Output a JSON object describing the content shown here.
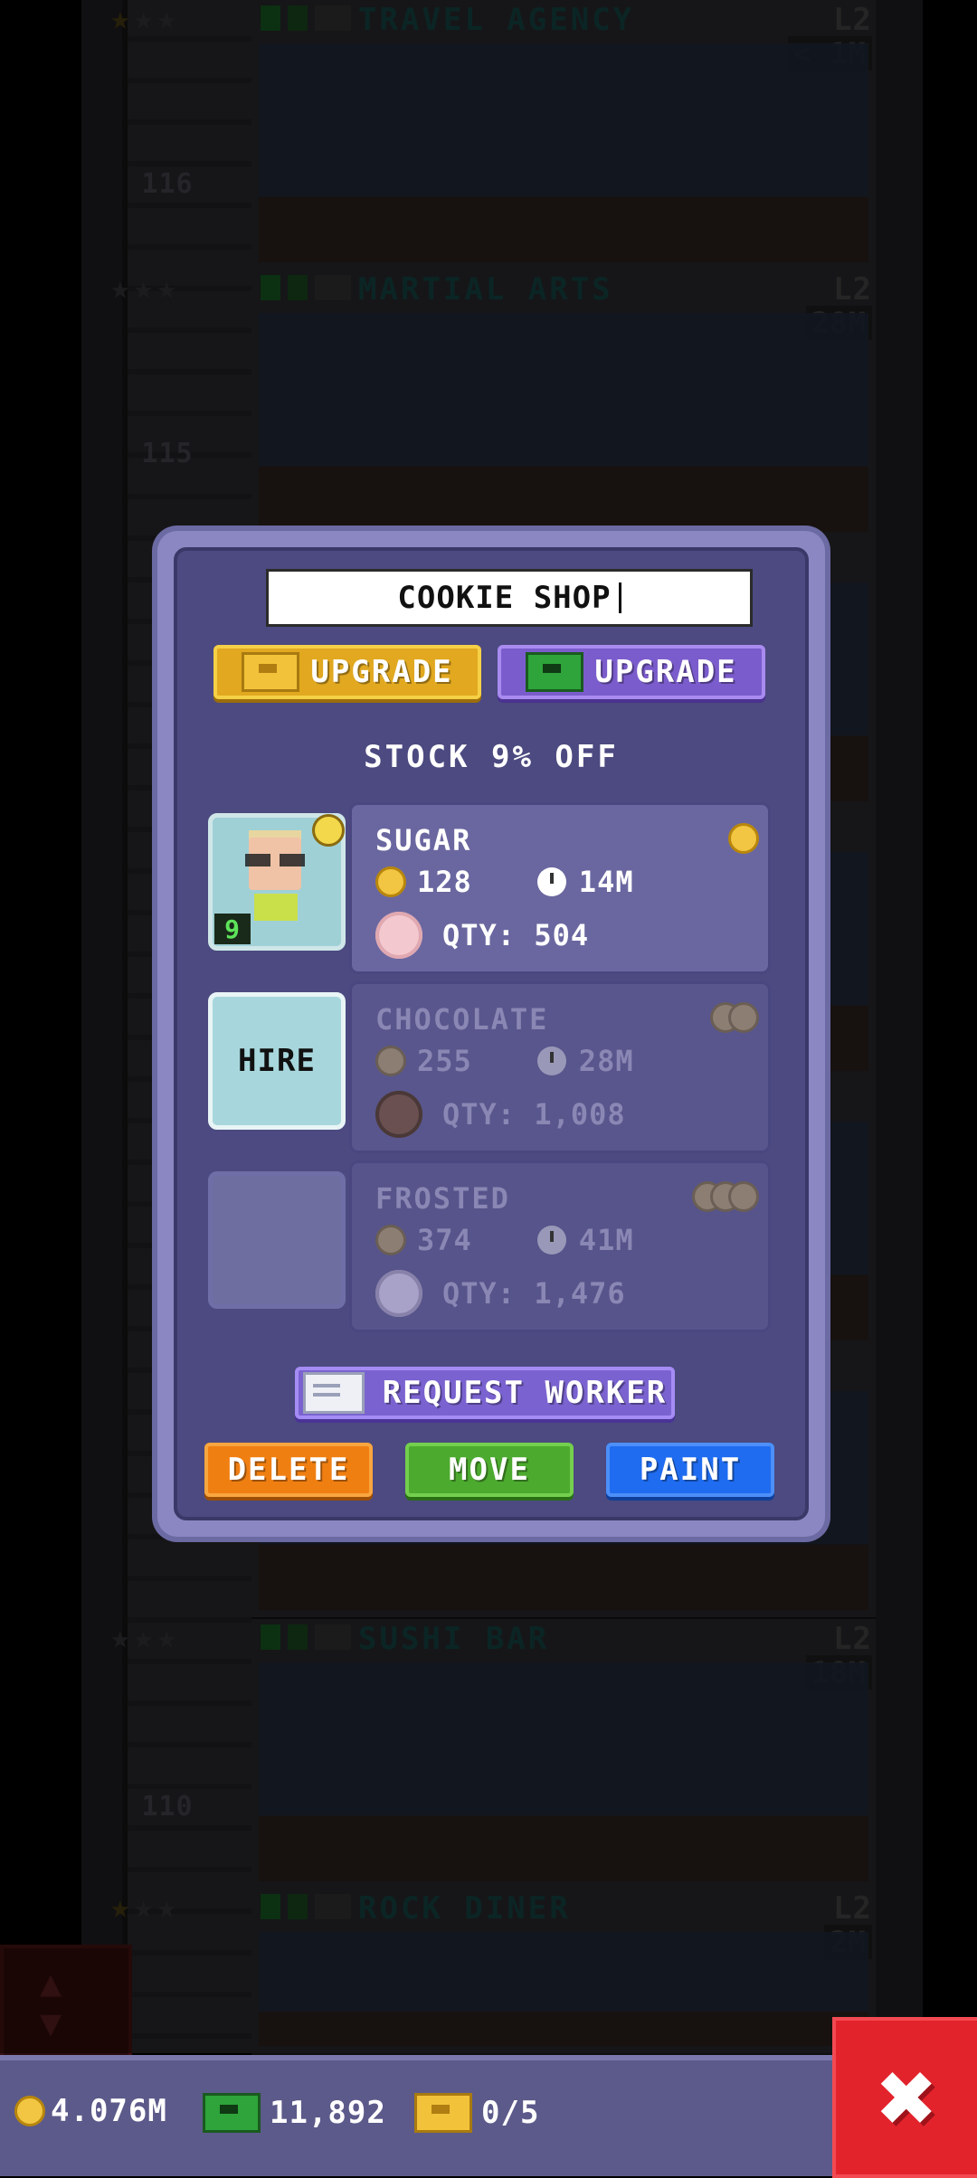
{
  "background": {
    "floors": [
      {
        "name": "TRAVEL AGENCY",
        "level": "L2",
        "time": "< 1M",
        "number": "116"
      },
      {
        "name": "MARTIAL ARTS",
        "level": "L2",
        "time": "28M",
        "number": "115"
      },
      {
        "name": "SUSHI BAR",
        "level": "L2",
        "time": "18M",
        "number": "110"
      },
      {
        "name": "ROCK DINER",
        "level": "L2",
        "time": "2M",
        "number": ""
      }
    ]
  },
  "dialog": {
    "title": "COOKIE SHOP",
    "upgrade_coins_label": "UPGRADE",
    "upgrade_bux_label": "UPGRADE",
    "stock_discount": "STOCK 9% OFF",
    "worker": {
      "level": "9",
      "mood": "neutral"
    },
    "hire_label": "HIRE",
    "stocks": [
      {
        "name": "SUGAR",
        "cost": "128",
        "time": "14M",
        "qty": "QTY: 504",
        "tier": 1
      },
      {
        "name": "CHOCOLATE",
        "cost": "255",
        "time": "28M",
        "qty": "QTY: 1,008",
        "tier": 2
      },
      {
        "name": "FROSTED",
        "cost": "374",
        "time": "41M",
        "qty": "QTY: 1,476",
        "tier": 3
      }
    ],
    "request_worker_label": "REQUEST WORKER",
    "delete_label": "DELETE",
    "move_label": "MOVE",
    "paint_label": "PAINT"
  },
  "bottom_bar": {
    "coins": "4.076M",
    "bux": "11,892",
    "tickets": "0/5"
  },
  "colors": {
    "dialog_bg": "#4c4a80",
    "upgrade_gold": "#e1a820",
    "upgrade_bux": "#7b5ccc",
    "delete": "#f07f12",
    "move": "#4caa2e",
    "paint": "#1f6cf0",
    "close": "#e3232c"
  }
}
